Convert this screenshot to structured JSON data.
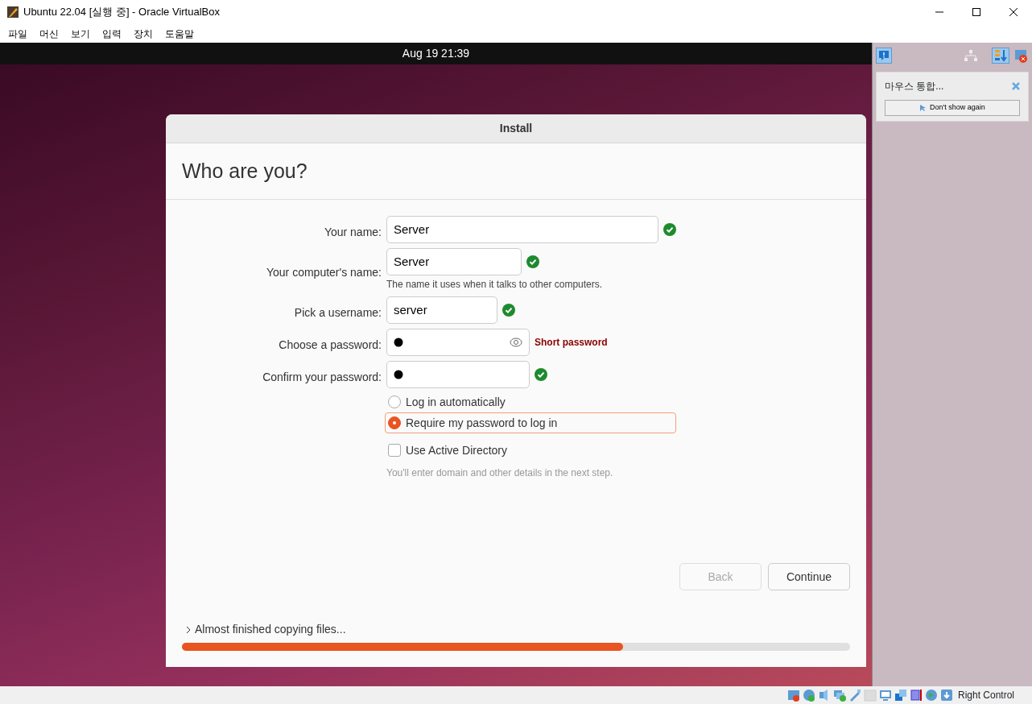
{
  "window": {
    "title": "Ubuntu 22.04 [실행 중] - Oracle VirtualBox"
  },
  "menu": [
    "파일",
    "머신",
    "보기",
    "입력",
    "장치",
    "도움말"
  ],
  "guest_top_bar": {
    "clock": "Aug 19  21:39"
  },
  "installer": {
    "title": "Install",
    "heading": "Who are you?",
    "fields": [
      {
        "label": "Your name:",
        "value": "Server",
        "kind": "text",
        "valid": true
      },
      {
        "label": "Your computer's name:",
        "value": "Server",
        "kind": "text",
        "valid": true,
        "hint": "The name it uses when it talks to other computers."
      },
      {
        "label": "Pick a username:",
        "value": "server",
        "kind": "text",
        "valid": true
      },
      {
        "label": "Choose a password:",
        "kind": "password",
        "valid": false,
        "error": "Short password"
      },
      {
        "label": "Confirm your password:",
        "kind": "password",
        "valid": true
      }
    ],
    "login_options": [
      {
        "label": "Log in automatically",
        "selected": false
      },
      {
        "label": "Require my password to log in",
        "selected": true
      }
    ],
    "active_directory": {
      "label": "Use Active Directory",
      "checked": false,
      "hint": "You'll enter domain and other details in the next step."
    },
    "buttons": [
      {
        "label": "Back",
        "disabled": true
      },
      {
        "label": "Continue",
        "disabled": false
      }
    ],
    "progress": {
      "label": "Almost finished copying files...",
      "level": 0.66
    }
  },
  "notification": {
    "message": "마우스 통합...",
    "button": "Don't show again"
  },
  "status_bar": {
    "host_key": "Right Control"
  }
}
